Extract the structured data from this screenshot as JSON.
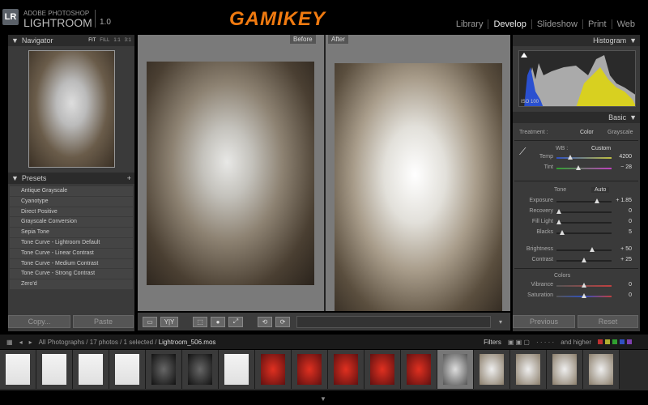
{
  "app": {
    "brand_line1": "ADOBE PHOTOSHOP",
    "brand_line2": "LIGHTROOM",
    "version": "1.0",
    "logo": "LR",
    "watermark": "GAMIKEY"
  },
  "modules": [
    {
      "label": "Library"
    },
    {
      "label": "Develop",
      "active": true
    },
    {
      "label": "Slideshow"
    },
    {
      "label": "Print"
    },
    {
      "label": "Web"
    }
  ],
  "navigator": {
    "title": "Navigator",
    "zoom": [
      "FIT",
      "FILL",
      "1:1",
      "3:1"
    ]
  },
  "presets": {
    "title": "Presets",
    "items": [
      "Antique Grayscale",
      "Cyanotype",
      "Direct Positive",
      "Grayscale Conversion",
      "Sepia Tone",
      "Tone Curve - Lightroom Default",
      "Tone Curve - Linear Contrast",
      "Tone Curve - Medium Contrast",
      "Tone Curve - Strong Contrast",
      "Zero'd"
    ]
  },
  "left_buttons": {
    "copy": "Copy...",
    "paste": "Paste"
  },
  "view": {
    "before": "Before",
    "after": "After"
  },
  "toolbar": {
    "yy": "Y|Y"
  },
  "histogram": {
    "title": "Histogram",
    "readout": "ISO 100"
  },
  "basic": {
    "title": "Basic",
    "treatment_label": "Treatment :",
    "color": "Color",
    "grayscale": "Grayscale",
    "wb_label": "WB :",
    "wb_value": "Custom",
    "temp": {
      "label": "Temp",
      "value": "4200",
      "pos": 0.25
    },
    "tint": {
      "label": "Tint",
      "value": "− 28",
      "pos": 0.4
    },
    "tone": "Tone",
    "auto": "Auto",
    "exposure": {
      "label": "Exposure",
      "value": "+ 1.85",
      "pos": 0.73
    },
    "recovery": {
      "label": "Recovery",
      "value": "0",
      "pos": 0.05
    },
    "fill_light": {
      "label": "Fill Light",
      "value": "0",
      "pos": 0.05
    },
    "blacks": {
      "label": "Blacks",
      "value": "5",
      "pos": 0.1
    },
    "brightness": {
      "label": "Brightness",
      "value": "+ 50",
      "pos": 0.65
    },
    "contrast": {
      "label": "Contrast",
      "value": "+ 25",
      "pos": 0.5
    },
    "colors": "Colors",
    "vibrance": {
      "label": "Vibrance",
      "value": "0",
      "pos": 0.5
    },
    "saturation": {
      "label": "Saturation",
      "value": "0",
      "pos": 0.5
    }
  },
  "right_buttons": {
    "previous": "Previous",
    "reset": "Reset"
  },
  "filmstrip": {
    "path": "All Photographs / 17 photos / 1 selected /",
    "file": "Lightroom_506.mos",
    "filters": "Filters",
    "rating": "and higher",
    "label_colors": [
      "#c03030",
      "#b0b030",
      "#30a030",
      "#3050c0",
      "#8040b0"
    ],
    "thumbs": [
      "white",
      "white",
      "white",
      "white",
      "black",
      "black",
      "white",
      "red",
      "red",
      "red",
      "red",
      "red",
      "selected",
      "veil",
      "veil",
      "veil",
      "veil"
    ]
  }
}
